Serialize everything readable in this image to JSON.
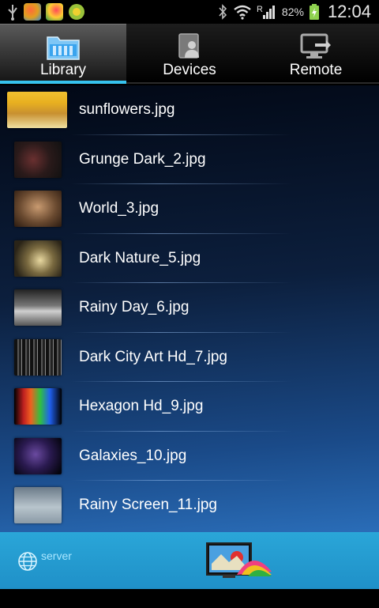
{
  "status": {
    "battery": "82%",
    "time": "12:04",
    "signal_letter": "R"
  },
  "tabs": [
    {
      "label": "Library",
      "icon": "folder-icon",
      "active": true
    },
    {
      "label": "Devices",
      "icon": "device-user-icon",
      "active": false
    },
    {
      "label": "Remote",
      "icon": "remote-screen-icon",
      "active": false
    }
  ],
  "files": [
    {
      "name": "sunflowers.jpg"
    },
    {
      "name": "Grunge Dark_2.jpg"
    },
    {
      "name": "World_3.jpg"
    },
    {
      "name": "Dark Nature_5.jpg"
    },
    {
      "name": "Rainy Day_6.jpg"
    },
    {
      "name": "Dark City Art Hd_7.jpg"
    },
    {
      "name": "Hexagon Hd_9.jpg"
    },
    {
      "name": "Galaxies_10.jpg"
    },
    {
      "name": "Rainy Screen_11.jpg"
    }
  ],
  "bottom": {
    "server_label": "server"
  },
  "colors": {
    "accent": "#36c2ee",
    "bottombar": "#2aa6d8"
  }
}
